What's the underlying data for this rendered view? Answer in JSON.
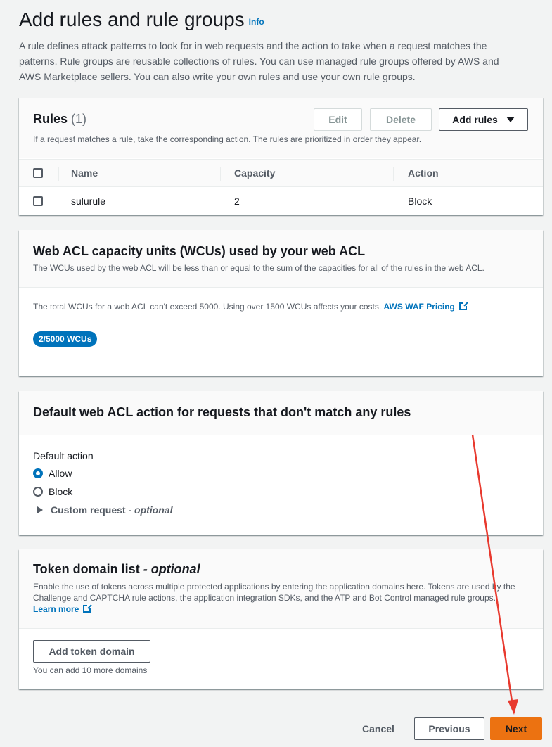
{
  "header": {
    "title": "Add rules and rule groups",
    "info": "Info",
    "description": "A rule defines attack patterns to look for in web requests and the action to take when a request matches the patterns. Rule groups are reusable collections of rules. You can use managed rule groups offered by AWS and AWS Marketplace sellers. You can also write your own rules and use your own rule groups."
  },
  "rules": {
    "title": "Rules",
    "count": "(1)",
    "subtitle": "If a request matches a rule, take the corresponding action. The rules are prioritized in order they appear.",
    "edit_label": "Edit",
    "delete_label": "Delete",
    "add_rules_label": "Add rules",
    "columns": [
      "Name",
      "Capacity",
      "Action"
    ],
    "rows": [
      {
        "name": "sulurule",
        "capacity": "2",
        "action": "Block"
      }
    ]
  },
  "wcu": {
    "title": "Web ACL capacity units (WCUs) used by your web ACL",
    "subtitle": "The WCUs used by the web ACL will be less than or equal to the sum of the capacities for all of the rules in the web ACL.",
    "note": "The total WCUs for a web ACL can't exceed 5000. Using over 1500 WCUs affects your costs.",
    "pricing_link": "AWS WAF Pricing",
    "badge": "2/5000 WCUs"
  },
  "default_action": {
    "title": "Default web ACL action for requests that don't match any rules",
    "label": "Default action",
    "options": [
      "Allow",
      "Block"
    ],
    "selected": "Allow",
    "custom_request": "Custom request",
    "optional": "- optional"
  },
  "token": {
    "title": "Token domain list",
    "optional": "- optional",
    "subtitle": "Enable the use of tokens across multiple protected applications by entering the application domains here. Tokens are used by the Challenge and CAPTCHA rule actions, the application integration SDKs, and the ATP and Bot Control managed rule groups.",
    "learn_more": "Learn more",
    "add_label": "Add token domain",
    "hint": "You can add 10 more domains"
  },
  "footer": {
    "cancel": "Cancel",
    "previous": "Previous",
    "next": "Next"
  },
  "colors": {
    "accent": "#0073bb",
    "primary_button": "#ec7211",
    "annotation": "#e8392e"
  }
}
